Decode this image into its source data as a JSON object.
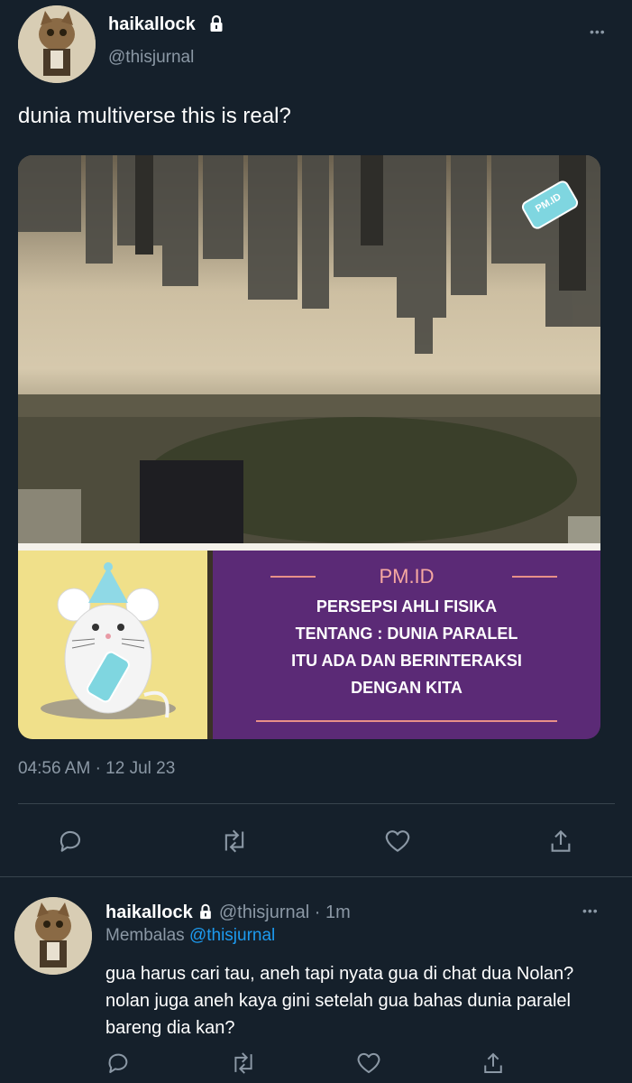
{
  "main_tweet": {
    "display_name": "haikallock",
    "handle": "@thisjurnal",
    "text": "dunia multiverse this is real?",
    "timestamp": "04:56 AM",
    "date": "12 Jul 23",
    "more_label": "•••",
    "media": {
      "watermark": "PM.ID",
      "banner_brand": "PM.ID",
      "banner_lines": [
        "PERSEPSI AHLI FISIKA",
        "TENTANG : DUNIA PARALEL",
        "ITU ADA DAN BERINTERAKSI",
        "DENGAN KITA"
      ]
    }
  },
  "reply_tweet": {
    "display_name": "haikallock",
    "handle": "@thisjurnal",
    "time_ago": "· 1m",
    "replying_prefix": "Membalas",
    "replying_to": "@thisjurnal",
    "text": "gua harus cari tau, aneh tapi nyata gua di chat dua Nolan? nolan juga aneh kaya gini setelah gua bahas dunia paralel bareng dia kan?",
    "more_label": "•••"
  },
  "icons": [
    "lock-icon",
    "reply-icon",
    "retweet-icon",
    "like-icon",
    "share-icon",
    "more-icon"
  ],
  "colors": {
    "background": "#15202b",
    "muted": "#8b98a5",
    "link": "#1d9bf0",
    "banner_purple": "#5b2a76",
    "banner_yellow": "#f0e08a"
  }
}
